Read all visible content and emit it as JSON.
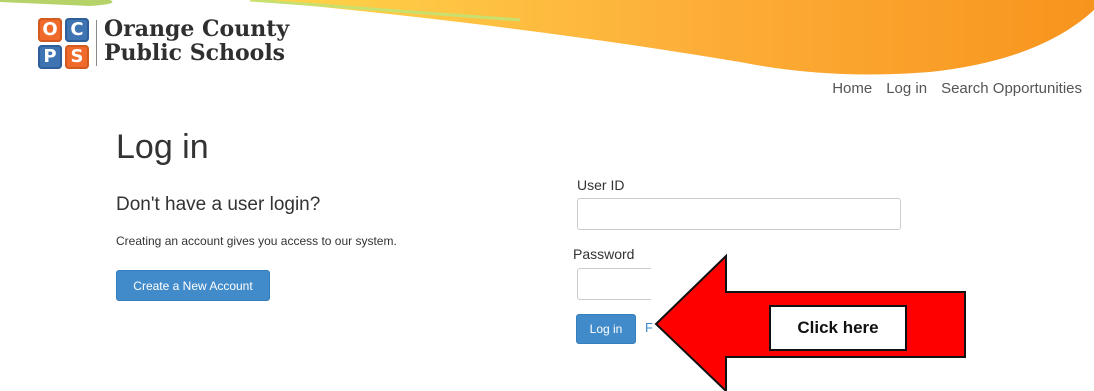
{
  "logo": {
    "letters": [
      "O",
      "C",
      "P",
      "S"
    ],
    "line1": "Orange County",
    "line2": "Public Schools"
  },
  "nav": {
    "home": "Home",
    "login": "Log in",
    "search": "Search Opportunities"
  },
  "page": {
    "title": "Log in",
    "subtitle": "Don't have a user login?",
    "info": "Creating an account gives you access to our system.",
    "create_button": "Create a New Account"
  },
  "form": {
    "userid_label": "User ID",
    "userid_value": "",
    "password_label": "Password",
    "password_value": "",
    "login_button": "Log in",
    "forgot_link_partial": "F"
  },
  "annotation": {
    "callout": "Click here"
  },
  "colors": {
    "banner_orange": "#f7941d",
    "banner_yellow": "#ffcb3d",
    "button_blue": "#428bca",
    "arrow_red": "#ff0000"
  }
}
